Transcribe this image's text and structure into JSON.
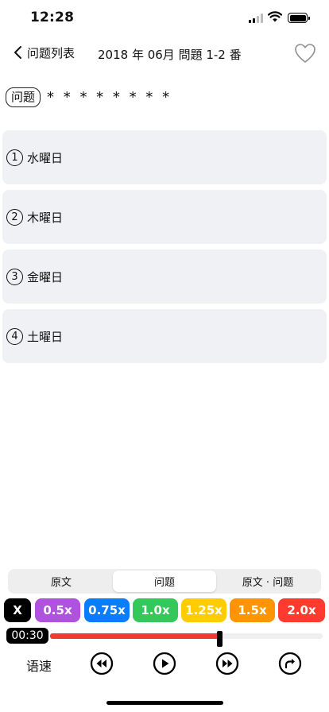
{
  "status": {
    "time": "12:28"
  },
  "nav": {
    "back_label": "问题列表",
    "title": "2018 年 06月 問題 1-2 番"
  },
  "question": {
    "tag": "问题",
    "text": "* * * * * * * *"
  },
  "options": [
    {
      "num": "1",
      "label": "水曜日"
    },
    {
      "num": "2",
      "label": "木曜日"
    },
    {
      "num": "3",
      "label": "金曜日"
    },
    {
      "num": "4",
      "label": "土曜日"
    }
  ],
  "segments": [
    "原文",
    "问题",
    "原文 · 问题"
  ],
  "active_segment": 1,
  "speeds": [
    {
      "label": "X",
      "color": "#000000"
    },
    {
      "label": "0.5x",
      "color": "#af52de"
    },
    {
      "label": "0.75x",
      "color": "#0a7cff"
    },
    {
      "label": "1.0x",
      "color": "#34c759"
    },
    {
      "label": "1.25x",
      "color": "#ffcc00"
    },
    {
      "label": "1.5x",
      "color": "#ff9500"
    },
    {
      "label": "2.0x",
      "color": "#ff3b30"
    }
  ],
  "player": {
    "time": "00:30",
    "progress": 0.62,
    "speed_label": "语速"
  },
  "icons": {
    "back": "chevron-left-icon",
    "favorite": "heart-outline-icon",
    "rewind": "rewind-icon",
    "play": "play-icon",
    "fast_forward": "fast-forward-icon",
    "redo": "redo-icon"
  }
}
